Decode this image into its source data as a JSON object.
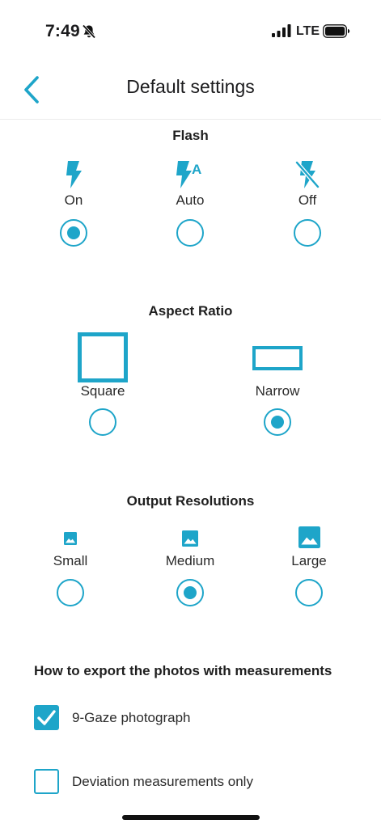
{
  "status_bar": {
    "time": "7:49",
    "network": "LTE"
  },
  "header": {
    "title": "Default settings"
  },
  "flash": {
    "title": "Flash",
    "options": [
      {
        "label": "On",
        "icon": "flash-on-icon",
        "selected": true
      },
      {
        "label": "Auto",
        "icon": "flash-auto-icon",
        "selected": false
      },
      {
        "label": "Off",
        "icon": "flash-off-icon",
        "selected": false
      }
    ]
  },
  "aspect_ratio": {
    "title": "Aspect Ratio",
    "options": [
      {
        "label": "Square",
        "icon": "square-ratio-icon",
        "selected": false
      },
      {
        "label": "Narrow",
        "icon": "narrow-ratio-icon",
        "selected": true
      }
    ]
  },
  "output_resolutions": {
    "title": "Output Resolutions",
    "options": [
      {
        "label": "Small",
        "icon": "image-small-icon",
        "selected": false
      },
      {
        "label": "Medium",
        "icon": "image-medium-icon",
        "selected": true
      },
      {
        "label": "Large",
        "icon": "image-large-icon",
        "selected": false
      }
    ]
  },
  "export": {
    "title": "How to export the photos with measurements",
    "options": [
      {
        "label": "9-Gaze photograph",
        "checked": true
      },
      {
        "label": "Deviation measurements only",
        "checked": false
      }
    ]
  },
  "colors": {
    "accent": "#1ea5c9",
    "text": "#1c1c1e"
  }
}
